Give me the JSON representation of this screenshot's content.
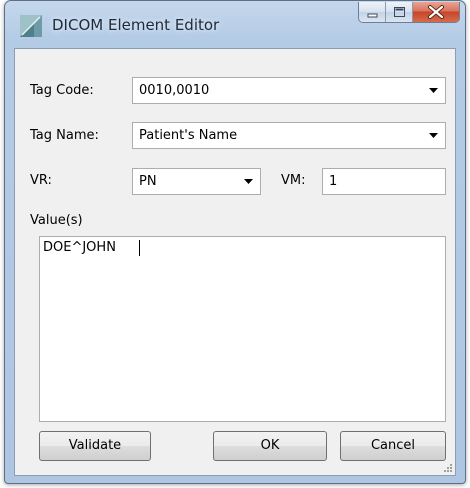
{
  "window": {
    "title": "DICOM Element Editor",
    "icon": "dicom-app-icon",
    "caption_buttons": [
      "minimize-icon",
      "maximize-icon",
      "close-icon"
    ]
  },
  "form": {
    "tag_code": {
      "label": "Tag Code:",
      "value": "0010,0010"
    },
    "tag_name": {
      "label": "Tag Name:",
      "value": "Patient's Name"
    },
    "vr": {
      "label": "VR:",
      "value": "PN"
    },
    "vm": {
      "label": "VM:",
      "value": "1"
    },
    "values": {
      "label": "Value(s)",
      "value": "DOE^JOHN"
    }
  },
  "buttons": {
    "validate": "Validate",
    "ok": "OK",
    "cancel": "Cancel"
  }
}
